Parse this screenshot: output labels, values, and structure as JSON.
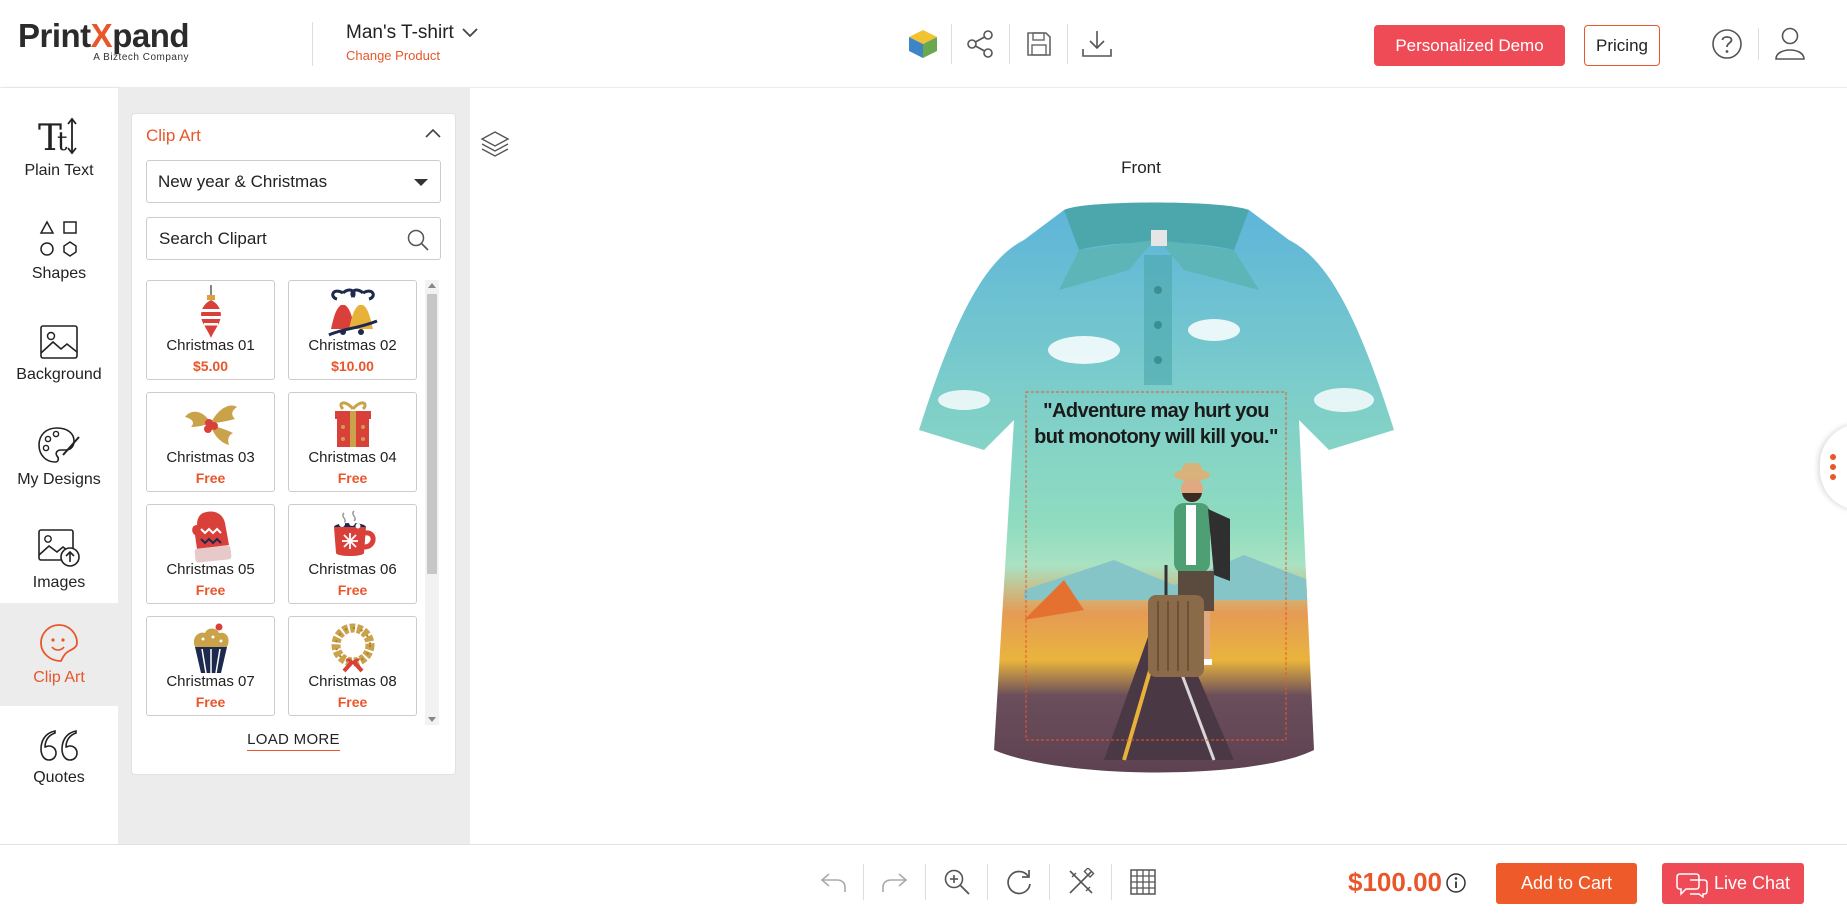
{
  "brand": {
    "logo_main": "Print",
    "logo_x": "X",
    "logo_end": "pand",
    "logo_sub": "A Biztech Company",
    "accent": "#e8562a",
    "demo_color": "#ee4b56"
  },
  "product": {
    "name": "Man's T-shirt",
    "change_label": "Change Product"
  },
  "header": {
    "tools": [
      "3d-cube-icon",
      "share-icon",
      "save-icon",
      "download-icon"
    ],
    "demo_label": "Personalized Demo",
    "pricing_label": "Pricing"
  },
  "leftnav": {
    "items": [
      {
        "label": "Plain Text",
        "icon": "plain-text-icon"
      },
      {
        "label": "Shapes",
        "icon": "shapes-icon"
      },
      {
        "label": "Background",
        "icon": "background-icon"
      },
      {
        "label": "My Designs",
        "icon": "palette-icon"
      },
      {
        "label": "Images",
        "icon": "images-icon"
      },
      {
        "label": "Clip Art",
        "icon": "clip-art-icon",
        "active": true
      },
      {
        "label": "Quotes",
        "icon": "quotes-icon"
      }
    ]
  },
  "clipart": {
    "title": "Clip Art",
    "category": "New year & Christmas",
    "search_placeholder": "Search Clipart",
    "items": [
      {
        "name": "Christmas 01",
        "price": "$5.00",
        "art": "ornament"
      },
      {
        "name": "Christmas 02",
        "price": "$10.00",
        "art": "bells"
      },
      {
        "name": "Christmas 03",
        "price": "Free",
        "art": "holly"
      },
      {
        "name": "Christmas 04",
        "price": "Free",
        "art": "gift"
      },
      {
        "name": "Christmas 05",
        "price": "Free",
        "art": "mitten"
      },
      {
        "name": "Christmas 06",
        "price": "Free",
        "art": "mug"
      },
      {
        "name": "Christmas 07",
        "price": "Free",
        "art": "cupcake"
      },
      {
        "name": "Christmas 08",
        "price": "Free",
        "art": "wreath"
      }
    ],
    "load_more": "LOAD MORE"
  },
  "canvas": {
    "side_label": "Front",
    "quote_line1": "\"Adventure may hurt you",
    "quote_line2": "but monotony will kill you.\""
  },
  "footer": {
    "tools": [
      "undo-icon",
      "redo-icon",
      "zoom-in-icon",
      "reset-icon",
      "magic-tools-icon",
      "grid-icon"
    ],
    "total": "$100.00",
    "add_to_cart": "Add to Cart",
    "live_chat": "Live Chat"
  }
}
